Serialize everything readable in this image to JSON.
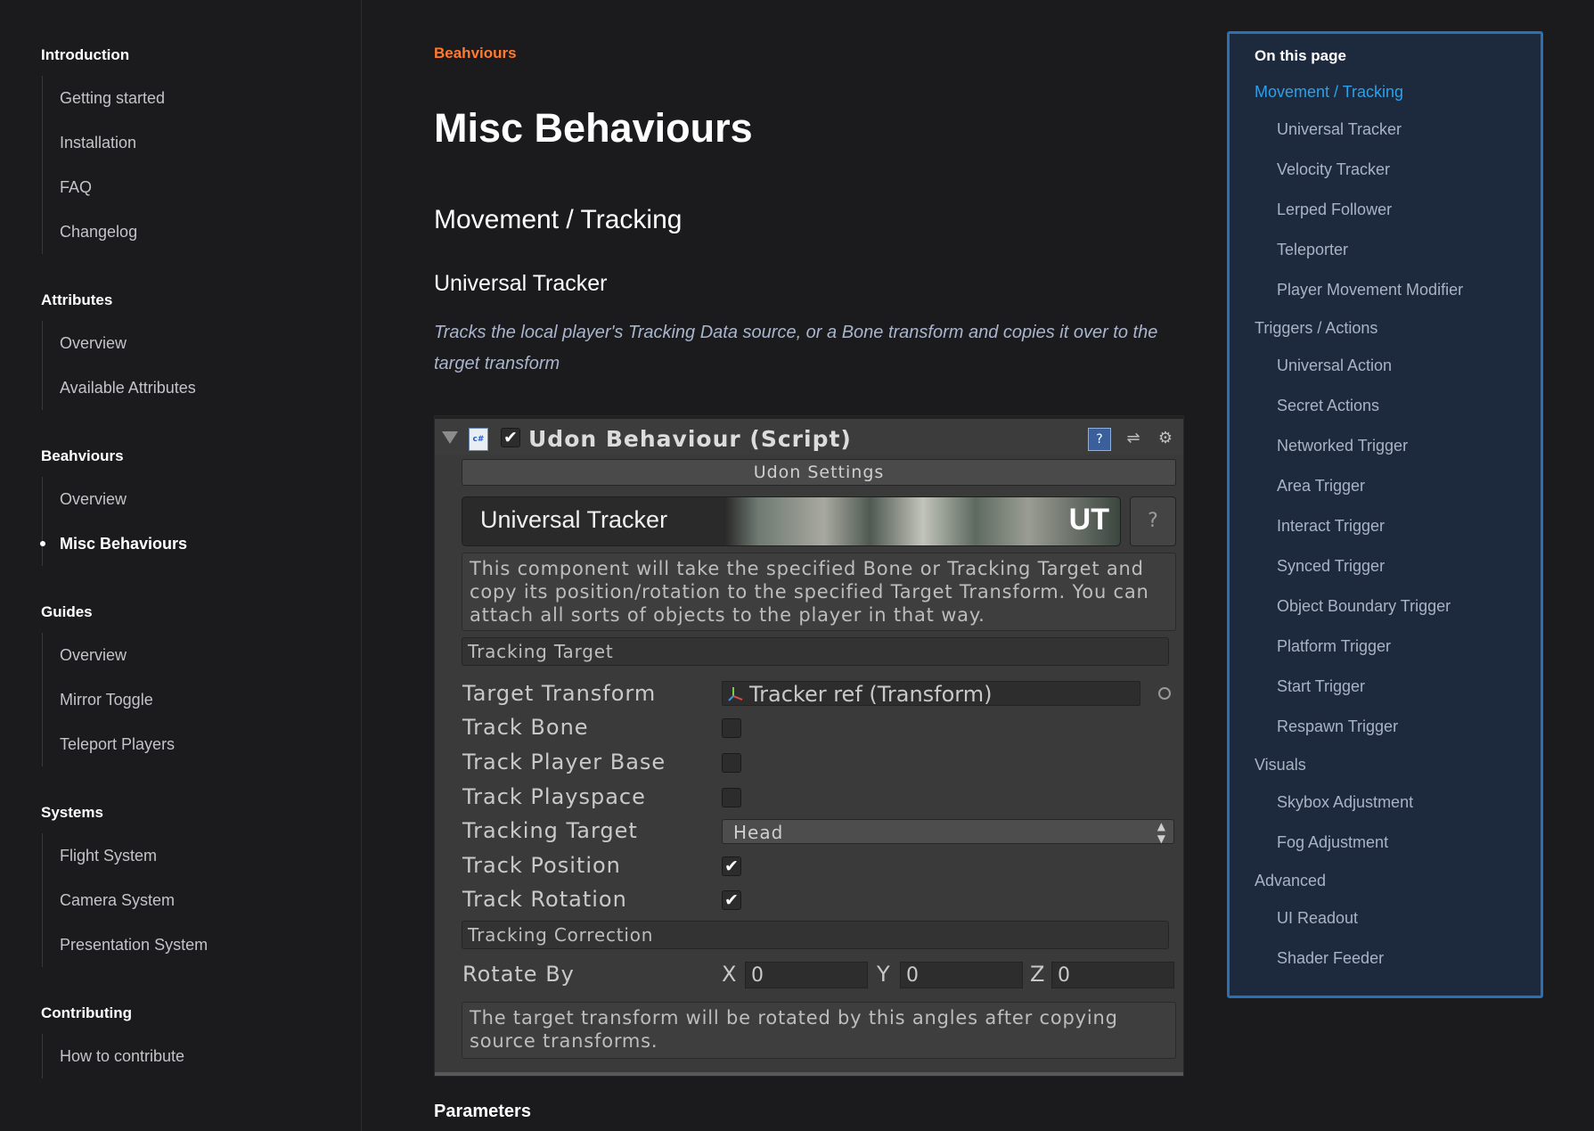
{
  "sidebar": {
    "sections": [
      {
        "title": "Introduction",
        "items": [
          "Getting started",
          "Installation",
          "FAQ",
          "Changelog"
        ]
      },
      {
        "title": "Attributes",
        "items": [
          "Overview",
          "Available Attributes"
        ]
      },
      {
        "title": "Beahviours",
        "items": [
          "Overview",
          "Misc Behaviours"
        ]
      },
      {
        "title": "Guides",
        "items": [
          "Overview",
          "Mirror Toggle",
          "Teleport Players"
        ]
      },
      {
        "title": "Systems",
        "items": [
          "Flight System",
          "Camera System",
          "Presentation System"
        ]
      },
      {
        "title": "Contributing",
        "items": [
          "How to contribute"
        ]
      }
    ],
    "active_item": "Misc Behaviours"
  },
  "main": {
    "eyebrow": "Beahviours",
    "title": "Misc Behaviours",
    "h2": "Movement / Tracking",
    "h3": "Universal Tracker",
    "description": "Tracks the local player's Tracking Data source, or a Bone transform and copies it over to the target transform",
    "next_heading": "Parameters"
  },
  "inspector": {
    "script_title": "Udon Behaviour (Script)",
    "cs_label": "c#",
    "udon_settings": "Udon Settings",
    "banner_name": "Universal Tracker",
    "banner_logo": "UT",
    "help_button": "?",
    "help_text": "This component will take the specified Bone or Tracking Target and copy its position/rotation to the specified Target Transform. You can attach all sorts of objects to the player in that way.",
    "group_tracking_target": "Tracking Target",
    "props": {
      "target_transform_label": "Target Transform",
      "target_transform_value": "Tracker ref (Transform)",
      "track_bone_label": "Track Bone",
      "track_bone_checked": false,
      "track_player_base_label": "Track Player Base",
      "track_player_base_checked": false,
      "track_playspace_label": "Track Playspace",
      "track_playspace_checked": false,
      "tracking_target_label": "Tracking Target",
      "tracking_target_value": "Head",
      "track_position_label": "Track Position",
      "track_position_checked": true,
      "track_rotation_label": "Track Rotation",
      "track_rotation_checked": true
    },
    "group_tracking_correction": "Tracking Correction",
    "rotate_by": {
      "label": "Rotate By",
      "x_label": "X",
      "x": "0",
      "y_label": "Y",
      "y": "0",
      "z_label": "Z",
      "z": "0"
    },
    "rotate_help": "The target transform will be rotated by this angles after copying source transforms.",
    "check_glyph": "✔"
  },
  "toc": {
    "title": "On this page",
    "entries": [
      {
        "level": 1,
        "label": "Movement / Tracking",
        "active": true
      },
      {
        "level": 2,
        "label": "Universal Tracker"
      },
      {
        "level": 2,
        "label": "Velocity Tracker"
      },
      {
        "level": 2,
        "label": "Lerped Follower"
      },
      {
        "level": 2,
        "label": "Teleporter"
      },
      {
        "level": 2,
        "label": "Player Movement Modifier"
      },
      {
        "level": 1,
        "label": "Triggers / Actions"
      },
      {
        "level": 2,
        "label": "Universal Action"
      },
      {
        "level": 2,
        "label": "Secret Actions"
      },
      {
        "level": 2,
        "label": "Networked Trigger"
      },
      {
        "level": 2,
        "label": "Area Trigger"
      },
      {
        "level": 2,
        "label": "Interact Trigger"
      },
      {
        "level": 2,
        "label": "Synced Trigger"
      },
      {
        "level": 2,
        "label": "Object Boundary Trigger"
      },
      {
        "level": 2,
        "label": "Platform Trigger"
      },
      {
        "level": 2,
        "label": "Start Trigger"
      },
      {
        "level": 2,
        "label": "Respawn Trigger"
      },
      {
        "level": 1,
        "label": "Visuals"
      },
      {
        "level": 2,
        "label": "Skybox Adjustment"
      },
      {
        "level": 2,
        "label": "Fog Adjustment"
      },
      {
        "level": 1,
        "label": "Advanced"
      },
      {
        "level": 2,
        "label": "UI Readout"
      },
      {
        "level": 2,
        "label": "Shader Feeder"
      }
    ]
  },
  "colors": {
    "background": "#1b1b1e",
    "accent_orange": "#ff7a2e",
    "accent_blue": "#2e9fe8",
    "toc_border": "#2a70b5",
    "toc_background": "#1d2a3e"
  }
}
